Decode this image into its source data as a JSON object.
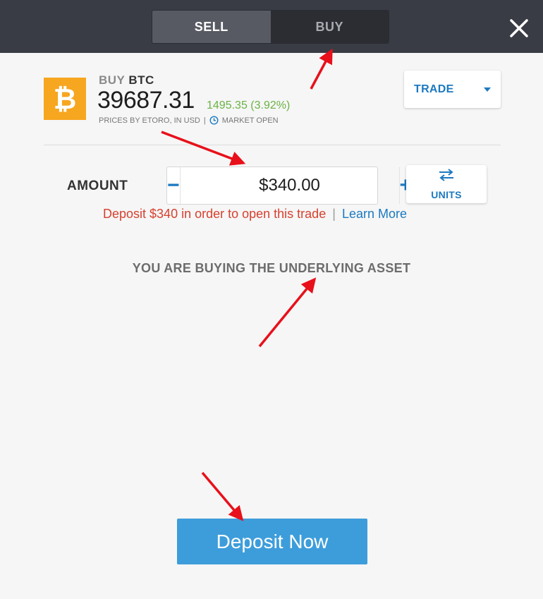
{
  "header": {
    "sell_label": "SELL",
    "buy_label": "BUY",
    "close_icon": "close-icon"
  },
  "instrument": {
    "logo_icon": "bitcoin-icon",
    "action": "BUY",
    "symbol": "BTC",
    "price": "39687.31",
    "change": "1495.35 (3.92%)",
    "price_source": "PRICES BY ETORO, IN USD",
    "separator": "|",
    "market_status_icon": "clock-icon",
    "market_status": "MARKET OPEN"
  },
  "mode_dropdown": {
    "selected": "TRADE",
    "icon": "chevron-down-icon"
  },
  "amount": {
    "label": "AMOUNT",
    "minus": "−",
    "value": "$340.00",
    "plus": "+",
    "units_label": "UNITS",
    "units_icon": "swap-arrows-icon"
  },
  "warning": {
    "text": "Deposit $340 in order to open this trade",
    "separator": "|",
    "link": "Learn More"
  },
  "notice": "YOU ARE BUYING THE UNDERLYING ASSET",
  "cta": {
    "label": "Deposit Now"
  },
  "colors": {
    "header_bg": "#3a3c45",
    "accent_blue": "#1c79c0",
    "button_blue": "#3d9ddb",
    "positive_green": "#6ab344",
    "warning_red": "#d7402f",
    "bitcoin_orange": "#f7a620",
    "annotation_red": "#e8101a"
  }
}
